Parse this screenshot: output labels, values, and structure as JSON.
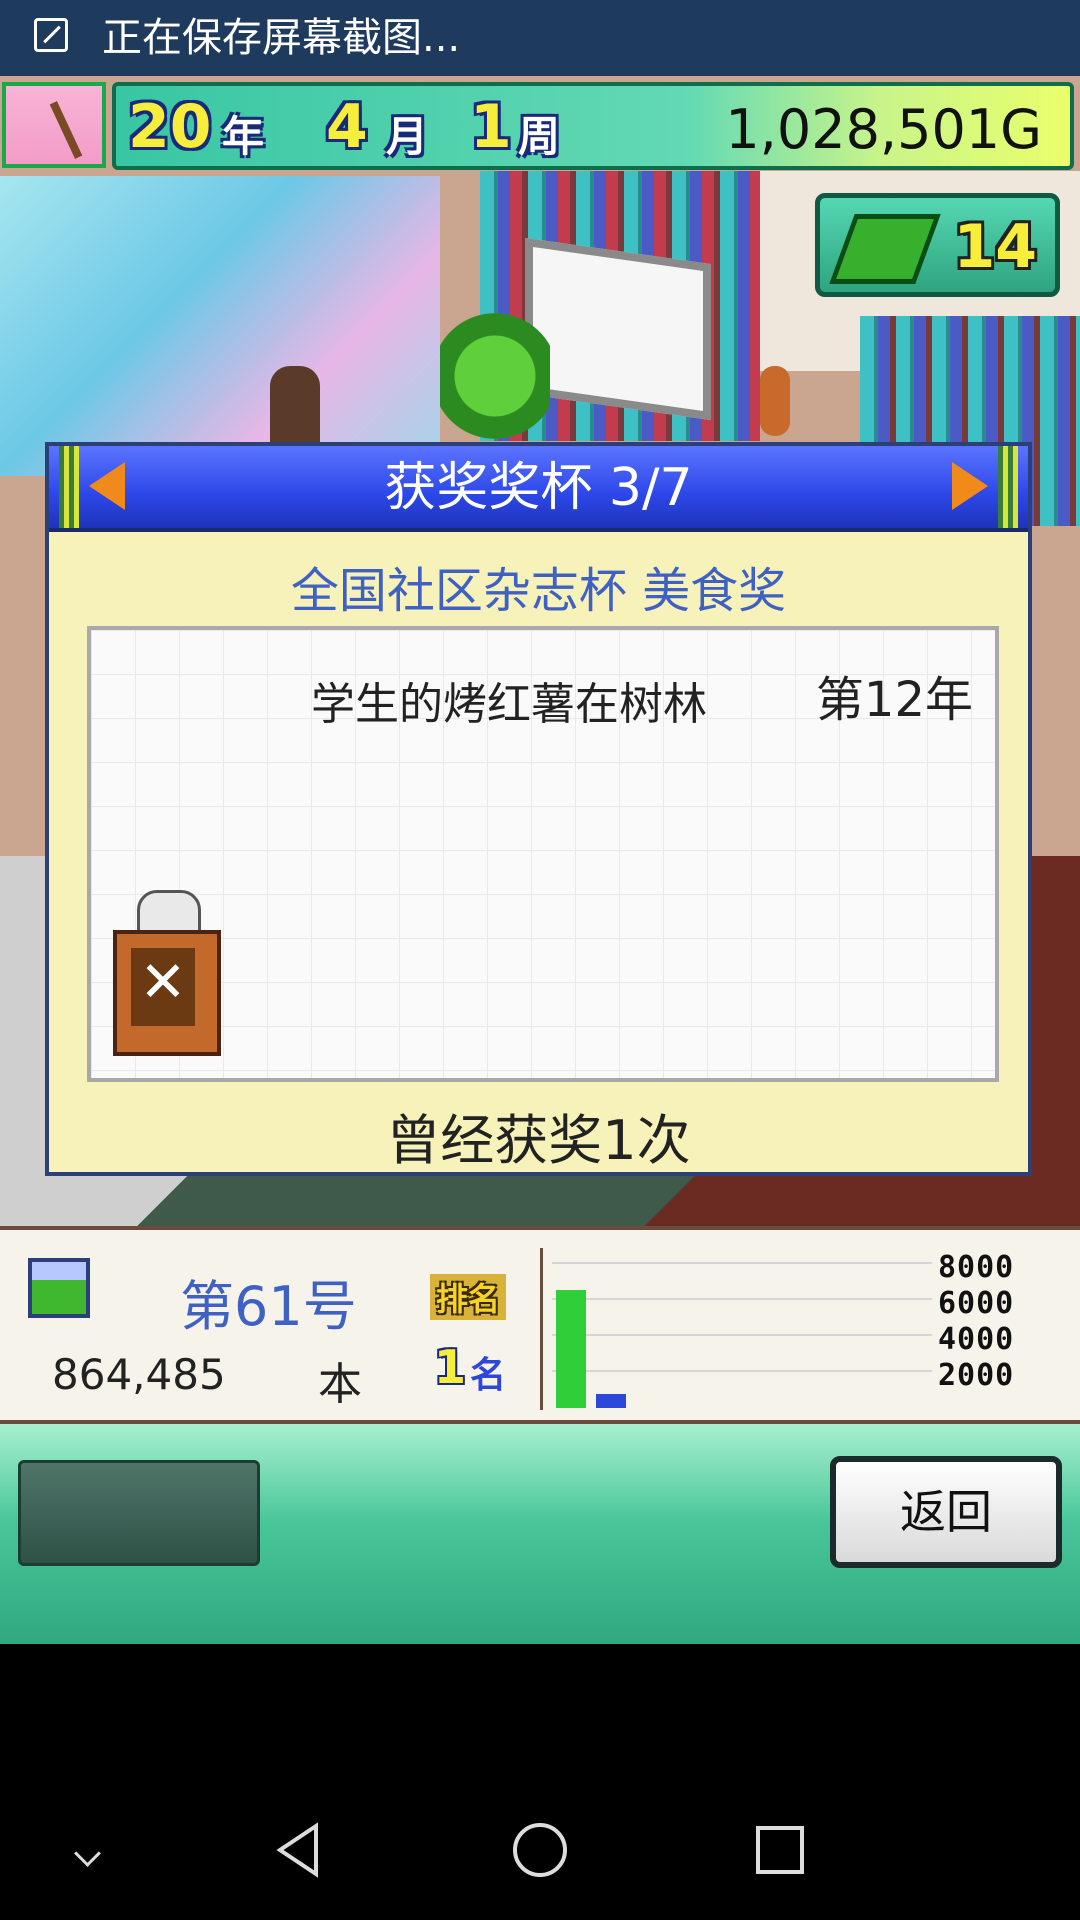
{
  "status_bar": {
    "text": "正在保存屏幕截图..."
  },
  "hud": {
    "year": "20",
    "year_unit": "年",
    "month": "4",
    "month_unit": "月",
    "week": "1",
    "week_unit": "周",
    "money": "1,028,501G"
  },
  "ticket": {
    "count": "14"
  },
  "dialog": {
    "title": "获奖奖杯 3/7",
    "award_name": "全国社区杂志杯 美食奖",
    "magazine_title": "学生的烤红薯在树林",
    "year": "第12年",
    "trophy_glyph": "✕",
    "win_count": "曾经获奖1次"
  },
  "stats": {
    "issue": "第61号",
    "sales": "864,485",
    "unit": "本",
    "rank_label": "排名",
    "rank": "1",
    "rank_unit": "名",
    "chart_ticks": [
      "8000",
      "6000",
      "4000",
      "2000"
    ]
  },
  "chart_data": {
    "type": "bar",
    "series": [
      {
        "values": [
          0.92,
          0.11
        ]
      }
    ],
    "bar_colors": [
      "#2fcf3a",
      "#2d47d8"
    ]
  },
  "actions": {
    "back_label": "返回"
  },
  "colors": {
    "accent": "#4061c4",
    "dialog_bg": "#f6f2b9",
    "header_blue": "#2c47e8"
  }
}
